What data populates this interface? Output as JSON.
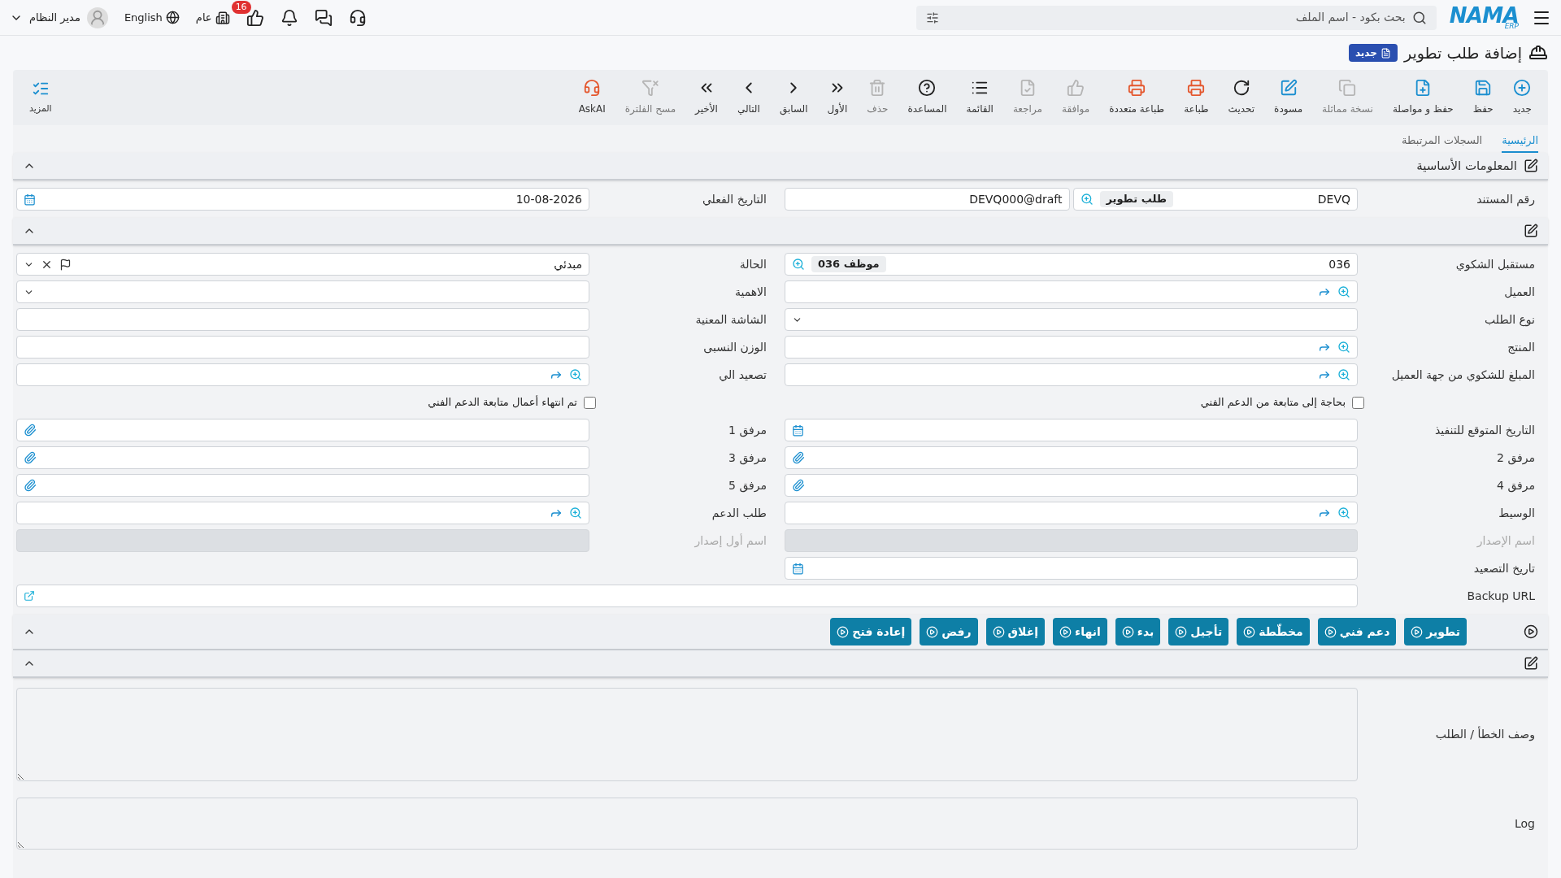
{
  "topbar": {
    "logo": "NAMA",
    "logo_sub": "ERP",
    "search": {
      "placeholder": "بحث بكود - اسم الملف"
    },
    "user": "مدير النظام",
    "language": "English",
    "branch": "عام",
    "approvals_badge": "16"
  },
  "page": {
    "title": "إضافة طلب تطوير",
    "badge": "جديد"
  },
  "toolbar": [
    {
      "label": "جديد",
      "disabled": false
    },
    {
      "label": "حفظ",
      "disabled": false
    },
    {
      "label": "حفظ و مواصلة",
      "disabled": false
    },
    {
      "label": "نسخة مماثلة",
      "disabled": true
    },
    {
      "label": "مسودة",
      "disabled": false
    },
    {
      "label": "تحديث",
      "disabled": false
    },
    {
      "label": "طباعة",
      "disabled": false
    },
    {
      "label": "طباعة متعددة",
      "disabled": false
    },
    {
      "label": "موافقة",
      "disabled": true
    },
    {
      "label": "مراجعة",
      "disabled": true
    },
    {
      "label": "القائمة",
      "disabled": false
    },
    {
      "label": "المساعدة",
      "disabled": false
    },
    {
      "label": "حذف",
      "disabled": true
    },
    {
      "label": "الأول",
      "disabled": false
    },
    {
      "label": "السابق",
      "disabled": false
    },
    {
      "label": "التالي",
      "disabled": false
    },
    {
      "label": "الأخير",
      "disabled": false
    },
    {
      "label": "مسح الفلترة",
      "disabled": true
    },
    {
      "label": "AskAI",
      "disabled": false
    }
  ],
  "more": "المزيد",
  "tabs": [
    {
      "label": "الرئيسية",
      "selected": true
    },
    {
      "label": "السجلات المرتبطة",
      "selected": false
    }
  ],
  "section_title": "المعلومات الأساسية",
  "header_fields": [
    {
      "kind": "docnumber",
      "label": "رقم المستند",
      "value": "DEVQ",
      "chip": "طلب تطوير",
      "serial": "DEVQ000@draft"
    },
    {
      "kind": "date",
      "label": "التاريخ الفعلي",
      "value": "10-08-2026"
    }
  ],
  "fields": [
    {
      "kind": "lookup",
      "label": "مستقبل الشكوي",
      "value": "036",
      "chip": "موظف 036"
    },
    {
      "kind": "status",
      "label": "الحالة",
      "value": "مبدئي"
    },
    {
      "kind": "lookup",
      "label": "العميل"
    },
    {
      "kind": "select",
      "label": "الاهمية"
    },
    {
      "kind": "select",
      "label": "نوع الطلب"
    },
    {
      "kind": "text",
      "label": "الشاشة المعنية",
      "disabled": false
    },
    {
      "kind": "lookup",
      "label": "المنتج"
    },
    {
      "kind": "text",
      "label": "الوزن النسبى",
      "disabled": false
    },
    {
      "kind": "lookup",
      "label": "المبلغ للشكوي من جهة العميل"
    },
    {
      "kind": "lookup",
      "label": "تصعيد الي"
    },
    {
      "kind": "checkbox",
      "label": "بحاجة إلى متابعة من الدعم الفني",
      "checked": false
    },
    {
      "kind": "checkbox",
      "label": "تم انتهاء أعمال متابعة الدعم الفني",
      "checked": false
    },
    {
      "kind": "date",
      "label": "التاريخ المتوقع للتنفيذ"
    },
    {
      "kind": "attachment",
      "label": "مرفق 1"
    },
    {
      "kind": "attachment",
      "label": "مرفق 2"
    },
    {
      "kind": "attachment",
      "label": "مرفق 3"
    },
    {
      "kind": "attachment",
      "label": "مرفق 4"
    },
    {
      "kind": "attachment",
      "label": "مرفق 5"
    },
    {
      "kind": "lookup",
      "label": "الوسيط"
    },
    {
      "kind": "lookup",
      "label": "طلب الدعم"
    },
    {
      "kind": "text",
      "label": "اسم الإصدار",
      "disabled": true
    },
    {
      "kind": "text",
      "label": "اسم أول إصدار",
      "disabled": true
    },
    {
      "kind": "date",
      "label": "تاريخ التصعيد"
    },
    {
      "kind": "empty"
    },
    {
      "kind": "url",
      "label": "Backup URL"
    }
  ],
  "actions": [
    "تطوير",
    "دعم فني",
    "مخطّطة",
    "تأجيل",
    "بدء",
    "انهاء",
    "إغلاق",
    "رفض",
    "إعادة فتح"
  ],
  "textareas": [
    {
      "label": "وصف الخطأ / الطلب"
    },
    {
      "label": "Log"
    }
  ]
}
